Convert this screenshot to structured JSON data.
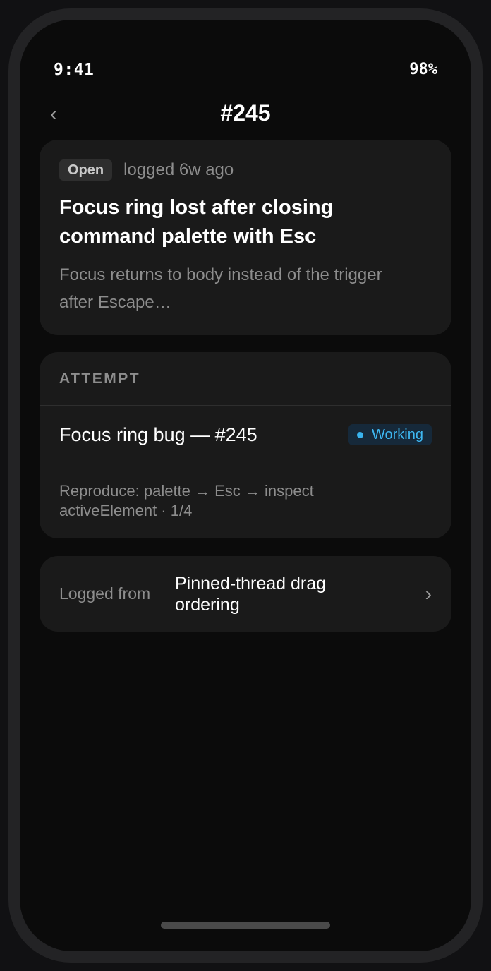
{
  "status_bar": {
    "time": "9:41",
    "battery": "98%"
  },
  "nav": {
    "back_icon": "chevron-left-icon",
    "title": "#245"
  },
  "issue": {
    "status": "Open",
    "logged": "logged 6w ago",
    "title": "Focus ring lost after closing command palette with Esc",
    "description": "Focus returns to body instead of the trigger after Escape…"
  },
  "attempt": {
    "section_label": "ATTEMPT",
    "name": "Focus ring bug — #245",
    "status": "Working",
    "status_color": "#3eb8f2",
    "note": "Reproduce: palette → Esc → inspect activeElement · 1/4"
  },
  "source": {
    "label": "Logged from",
    "value": "Pinned-thread drag ordering",
    "chevron_icon": "chevron-right-icon"
  }
}
